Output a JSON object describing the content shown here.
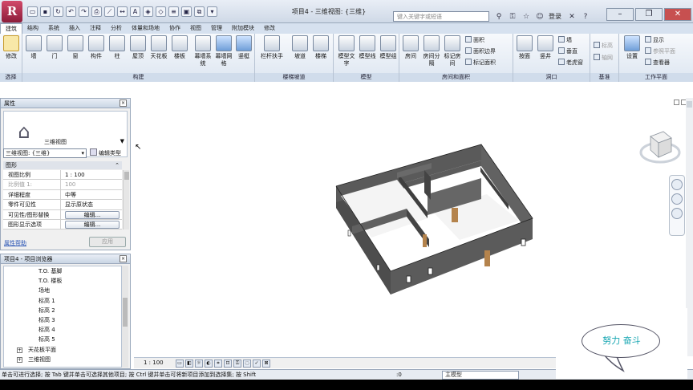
{
  "window": {
    "title": "项目4 - 三维视图: {三维}",
    "search_placeholder": "键入关键字或短语",
    "login": "登录"
  },
  "ribbon": {
    "tabs": [
      "建筑",
      "结构",
      "系统",
      "插入",
      "注释",
      "分析",
      "体量和场地",
      "协作",
      "视图",
      "管理",
      "附加模块",
      "修改"
    ],
    "active_tab": "建筑",
    "groups": {
      "select": {
        "label": "选择",
        "modify": "修改"
      },
      "build": {
        "label": "构建",
        "items": [
          "墙",
          "门",
          "窗",
          "构件",
          "柱",
          "屋顶",
          "天花板",
          "楼板",
          "幕墙系统",
          "幕墙网格",
          "竖梃"
        ]
      },
      "circulation": {
        "label": "楼梯坡道",
        "items": [
          "栏杆扶手",
          "坡道",
          "楼梯"
        ]
      },
      "model": {
        "label": "模型",
        "items": [
          "模型文字",
          "模型线",
          "模型组"
        ]
      },
      "room": {
        "label": "房间和面积",
        "items": [
          "房间",
          "房间分隔",
          "标记房间",
          "面积",
          "面积边界",
          "标记面积"
        ]
      },
      "opening": {
        "label": "洞口",
        "items": [
          "按面",
          "竖井",
          "墙",
          "垂直",
          "老虎窗"
        ]
      },
      "datum": {
        "label": "基准",
        "items": [
          "标高",
          "轴网"
        ]
      },
      "workplane": {
        "label": "工作平面",
        "items": [
          "设置",
          "显示",
          "参照平面",
          "查看器"
        ]
      }
    }
  },
  "properties": {
    "title": "属性",
    "type_name": "三维视图",
    "view_selector": "三维视图: {三维}",
    "edit_type": "编辑类型",
    "group": "图形",
    "rows": [
      {
        "key": "视图比例",
        "value": "1 : 100"
      },
      {
        "key": "比例值 1:",
        "value": "100"
      },
      {
        "key": "详细程度",
        "value": "中等"
      },
      {
        "key": "零件可见性",
        "value": "显示原状态"
      },
      {
        "key": "可见性/图形替换",
        "value": "编辑..."
      },
      {
        "key": "图形显示选项",
        "value": "编辑..."
      }
    ],
    "help_link": "属性帮助",
    "apply": "应用"
  },
  "browser": {
    "title": "项目4 - 项目浏览器",
    "items": [
      "T.O. 基脚",
      "T.O. 楼板",
      "场地",
      "标高 1",
      "标高 2",
      "标高 3",
      "标高 4",
      "标高 5",
      "天花板平面",
      "三维视图"
    ]
  },
  "viewbar": {
    "scale": "1 : 100"
  },
  "status": {
    "text": "单击可进行选择; 按 Tab 键并单击可选择其他项目; 按 Ctrl 键并单击可将新项目添加到选择集; 按 Shift",
    "zero": ":0",
    "model": "主模型"
  },
  "watermark": {
    "text": "努力  奋斗"
  },
  "colors": {
    "wall": "#555555",
    "door": "#b4834c",
    "accent": "#16a6b2"
  }
}
